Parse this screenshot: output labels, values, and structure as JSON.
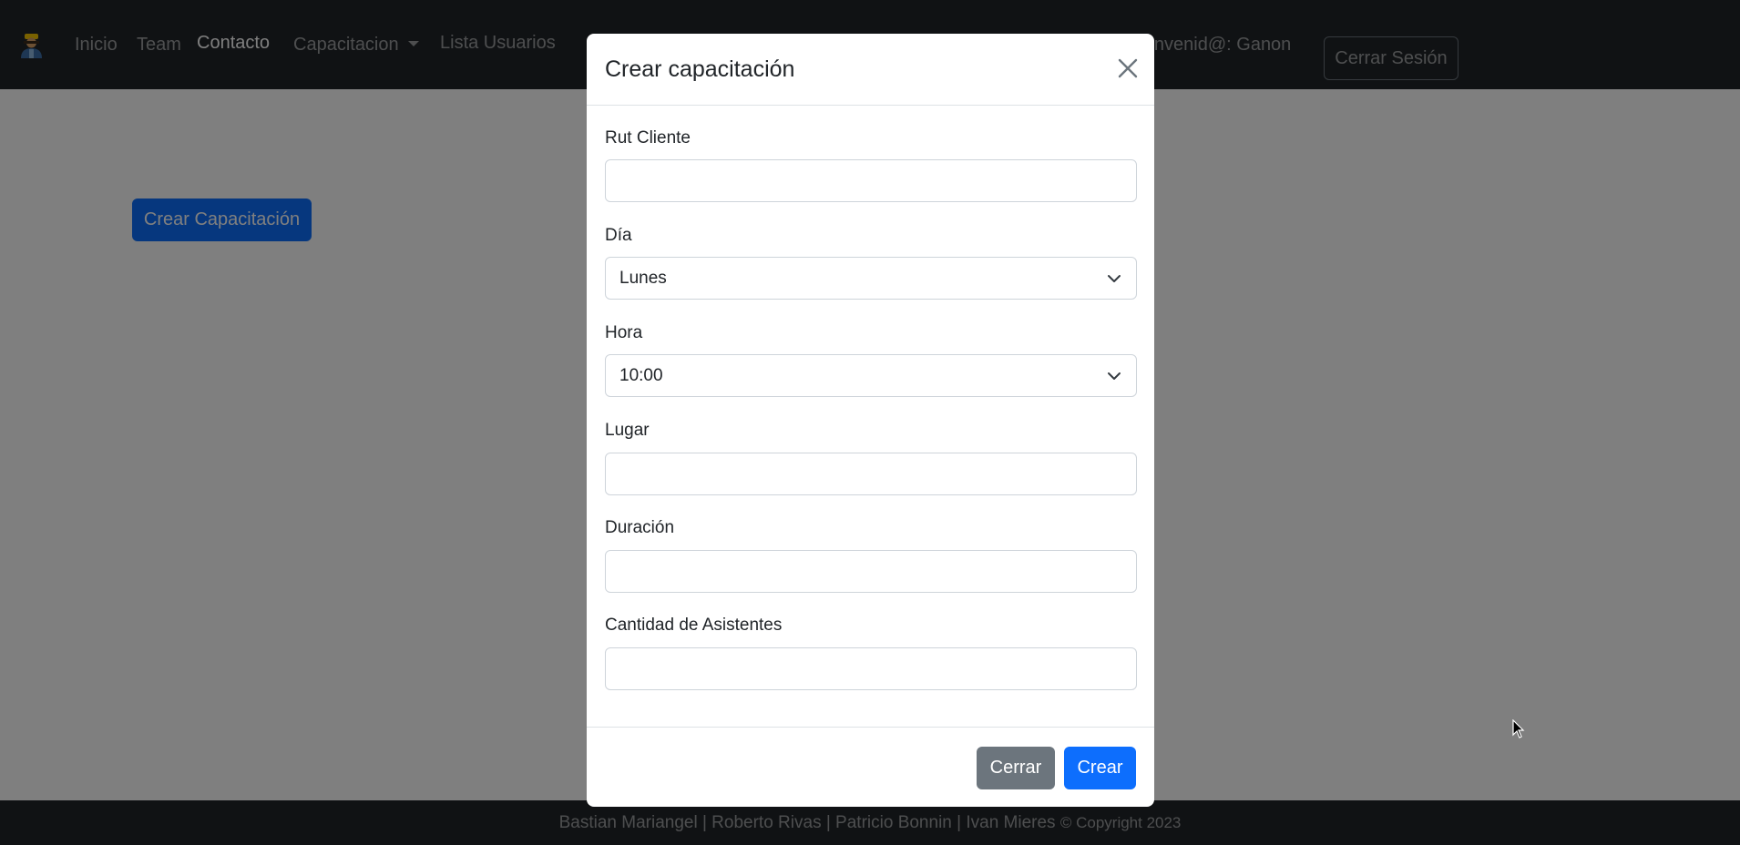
{
  "navbar": {
    "logo_icon": "worker-avatar-icon",
    "links": [
      {
        "label": "Inicio"
      },
      {
        "label": "Team"
      },
      {
        "label": "Contacto"
      },
      {
        "label": "Capacitacion"
      },
      {
        "label": "Lista Usuarios"
      }
    ],
    "welcome": "Bienvenid@: Ganon",
    "logout_label": "Cerrar Sesión"
  },
  "main": {
    "create_button_label": "Crear Capacitación"
  },
  "modal": {
    "title": "Crear capacitación",
    "close_icon": "close-icon",
    "fields": {
      "rut": {
        "label": "Rut Cliente",
        "value": ""
      },
      "dia": {
        "label": "Día",
        "selected": "Lunes"
      },
      "hora": {
        "label": "Hora",
        "selected": "10:00"
      },
      "lugar": {
        "label": "Lugar",
        "value": ""
      },
      "duracion": {
        "label": "Duración",
        "value": ""
      },
      "asistentes": {
        "label": "Cantidad de Asistentes",
        "value": ""
      }
    },
    "buttons": {
      "close_label": "Cerrar",
      "create_label": "Crear"
    }
  },
  "footer": {
    "authors": "Bastian Mariangel | Roberto Rivas | Patricio Bonnin | Ivan Mieres",
    "copyright": "© Copyright 2023"
  },
  "colors": {
    "navbar_bg": "#212529",
    "primary": "#0d6efd",
    "secondary": "#6c757d",
    "backdrop": "rgba(0,0,0,0.5)"
  }
}
